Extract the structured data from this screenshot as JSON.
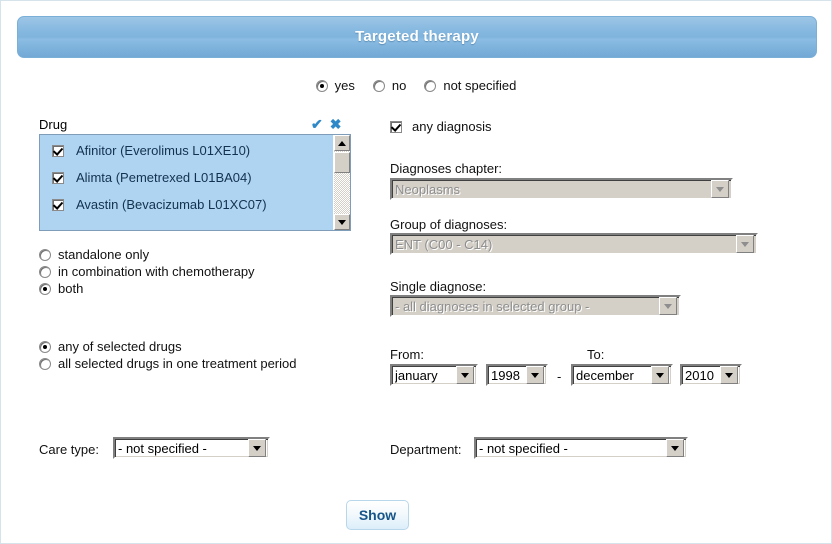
{
  "header": {
    "title": "Targeted therapy"
  },
  "therapy_state": {
    "options": [
      {
        "label": "yes",
        "selected": true
      },
      {
        "label": "no",
        "selected": false
      },
      {
        "label": "not specified",
        "selected": false
      }
    ]
  },
  "drug_list": {
    "column_header": "Drug",
    "select_all_icon": "check-icon",
    "select_all_glyph": "✔",
    "clear_all_icon": "close-icon",
    "clear_all_glyph": "✖",
    "icon_color": "#2f89c8",
    "selection_color": "#aed4f2",
    "items": [
      {
        "label": "Afinitor (Everolimus L01XE10)",
        "checked": true
      },
      {
        "label": "Alimta (Pemetrexed L01BA04)",
        "checked": true
      },
      {
        "label": "Avastin (Bevacizumab L01XC07)",
        "checked": true
      }
    ]
  },
  "administration_mode": {
    "options": [
      {
        "label": "standalone only",
        "selected": false
      },
      {
        "label": "in combination with chemotherapy",
        "selected": false
      },
      {
        "label": "both",
        "selected": true
      }
    ]
  },
  "drug_match_mode": {
    "options": [
      {
        "label": "any of selected drugs",
        "selected": true
      },
      {
        "label": "all selected drugs in one treatment period",
        "selected": false
      }
    ]
  },
  "diagnosis": {
    "any_diagnosis_label": "any diagnosis",
    "any_diagnosis_checked": true,
    "chapter_label": "Diagnoses chapter:",
    "chapter_value": "Neoplasms",
    "chapter_disabled": true,
    "group_label": "Group of diagnoses:",
    "group_value": "ENT (C00 - C14)",
    "group_disabled": true,
    "single_label": "Single diagnose:",
    "single_value": "- all diagnoses in selected group -",
    "single_disabled": true
  },
  "period": {
    "from_label": "From:",
    "to_label": "To:",
    "separator": "-",
    "from_month": "january",
    "from_year": "1998",
    "to_month": "december",
    "to_year": "2010"
  },
  "care_type": {
    "label": "Care type:",
    "value": "- not specified -"
  },
  "department": {
    "label": "Department:",
    "value": "- not specified -"
  },
  "actions": {
    "show_label": "Show"
  }
}
